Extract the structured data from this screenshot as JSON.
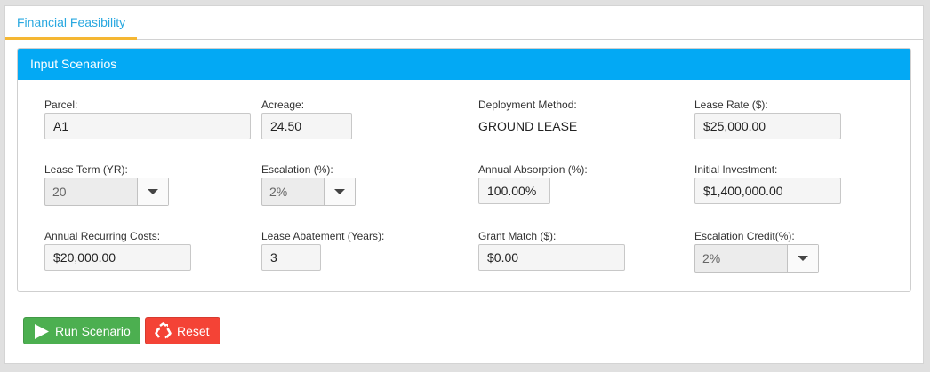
{
  "tabs": [
    {
      "label": "Financial Feasibility",
      "active": true
    }
  ],
  "panel": {
    "title": "Input Scenarios"
  },
  "fields": {
    "parcel": {
      "label": "Parcel:",
      "value": "A1"
    },
    "acreage": {
      "label": "Acreage:",
      "value": "24.50"
    },
    "deployment_method": {
      "label": "Deployment Method:",
      "value": "GROUND LEASE"
    },
    "lease_rate": {
      "label": "Lease Rate ($):",
      "value": "$25,000.00"
    },
    "lease_term": {
      "label": "Lease Term (YR):",
      "value": "20"
    },
    "escalation": {
      "label": "Escalation (%):",
      "value": "2%"
    },
    "annual_absorption": {
      "label": "Annual Absorption (%):",
      "value": "100.00%"
    },
    "initial_investment": {
      "label": "Initial Investment:",
      "value": "$1,400,000.00"
    },
    "annual_recurring_costs": {
      "label": "Annual Recurring Costs:",
      "value": "$20,000.00"
    },
    "lease_abatement": {
      "label": "Lease Abatement (Years):",
      "value": "3"
    },
    "grant_match": {
      "label": "Grant Match ($):",
      "value": "$0.00"
    },
    "escalation_credit": {
      "label": "Escalation Credit(%):",
      "value": "2%"
    }
  },
  "buttons": {
    "run": {
      "label": "Run Scenario",
      "icon": "play-icon"
    },
    "reset": {
      "label": "Reset",
      "icon": "recycle-icon"
    }
  },
  "colors": {
    "header_blue": "#03a9f4",
    "tab_text": "#29a8e0",
    "tab_underline": "#f5b733",
    "run_green": "#4caf50",
    "reset_red": "#f44336"
  }
}
